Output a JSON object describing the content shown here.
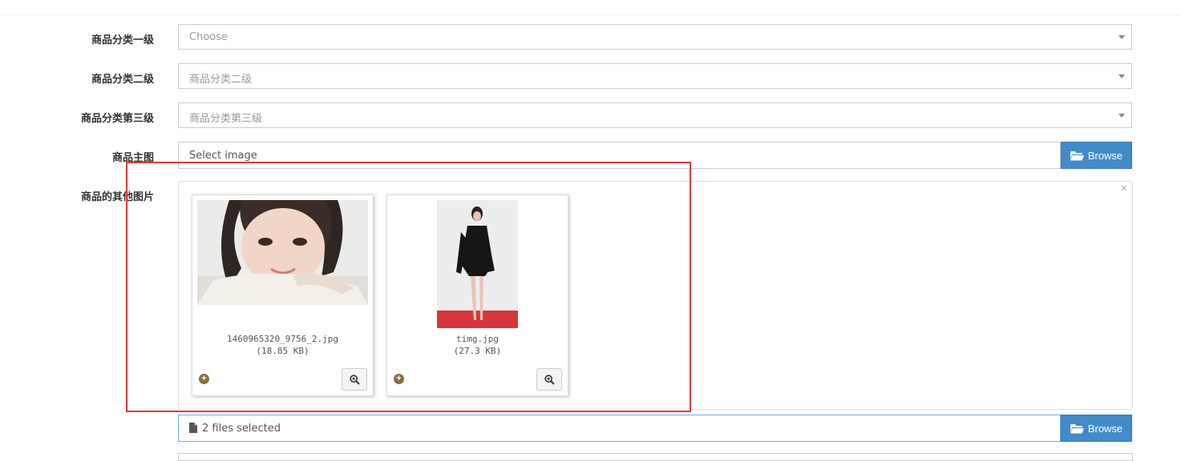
{
  "form": {
    "level1": {
      "label": "商品分类一级",
      "value": "Choose"
    },
    "level2": {
      "label": "商品分类二级",
      "value": "商品分类二级"
    },
    "level3": {
      "label": "商品分类第三级",
      "value": "商品分类第三级"
    },
    "main_image": {
      "label": "商品主图",
      "placeholder": "Select image",
      "browse_label": "Browse"
    },
    "other_images": {
      "label": "商品的其他图片",
      "close_symbol": "×",
      "files": [
        {
          "name": "1460965320_9756_2.jpg",
          "size": "(18.85 KB)"
        },
        {
          "name": "timg.jpg",
          "size": "(27.3 KB)"
        }
      ],
      "status_text": "2 files selected",
      "browse_label": "Browse"
    }
  },
  "colors": {
    "browse_bg": "#428bca",
    "highlight_box": "#e53935",
    "plus_icon": "#8a6d3b"
  },
  "icons": [
    "folder-open-icon",
    "zoom-in-icon",
    "plus-circle-icon",
    "file-icon",
    "close-icon",
    "caret-down-icon"
  ]
}
